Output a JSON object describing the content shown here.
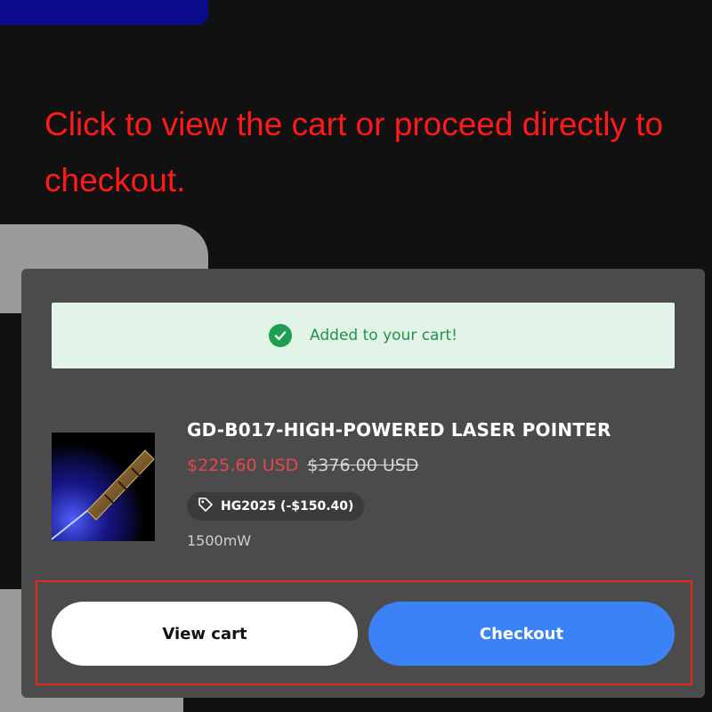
{
  "instruction": "Click to view the cart or proceed directly to checkout.",
  "cart_notice": {
    "message": "Added to your cart!",
    "icon": "check-circle-icon"
  },
  "product": {
    "title": "GD-B017-HIGH-POWERED LASER POINTER",
    "sale_price": "$225.60 USD",
    "original_price": "$376.00 USD",
    "discount_code": "HG2025 (-$150.40)",
    "variant": "1500mW"
  },
  "actions": {
    "view_cart_label": "View cart",
    "checkout_label": "Checkout"
  },
  "colors": {
    "accent": "#3b82f6",
    "sale_price": "#e8454c",
    "success": "#1e9e4f",
    "highlight": "#e8261e"
  }
}
